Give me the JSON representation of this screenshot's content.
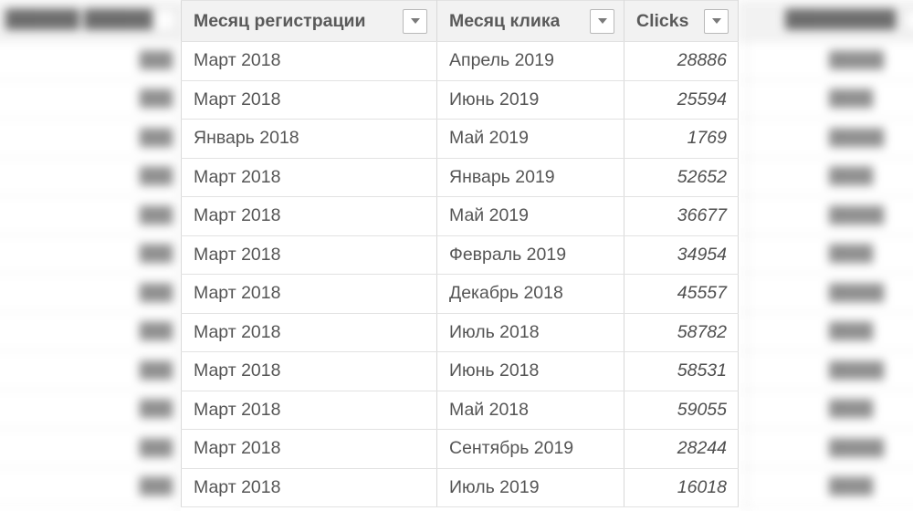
{
  "table": {
    "columns": [
      {
        "key": "reg_month",
        "label": "Месяц регистрации",
        "filter_icon": "chevron-down-icon",
        "align": "left"
      },
      {
        "key": "click_month",
        "label": "Месяц клика",
        "filter_icon": "chevron-down-icon",
        "align": "left"
      },
      {
        "key": "clicks",
        "label": "Clicks",
        "filter_icon": "chevron-down-icon",
        "align": "right"
      }
    ],
    "rows": [
      {
        "reg_month": "Март 2018",
        "click_month": "Апрель 2019",
        "clicks": "28886"
      },
      {
        "reg_month": "Март 2018",
        "click_month": "Июнь 2019",
        "clicks": "25594"
      },
      {
        "reg_month": "Январь 2018",
        "click_month": "Май 2019",
        "clicks": "1769"
      },
      {
        "reg_month": "Март 2018",
        "click_month": "Январь 2019",
        "clicks": "52652"
      },
      {
        "reg_month": "Март 2018",
        "click_month": "Май 2019",
        "clicks": "36677"
      },
      {
        "reg_month": "Март 2018",
        "click_month": "Февраль 2019",
        "clicks": "34954"
      },
      {
        "reg_month": "Март 2018",
        "click_month": "Декабрь 2018",
        "clicks": "45557"
      },
      {
        "reg_month": "Март 2018",
        "click_month": "Июль 2018",
        "clicks": "58782"
      },
      {
        "reg_month": "Март 2018",
        "click_month": "Июнь 2018",
        "clicks": "58531"
      },
      {
        "reg_month": "Март 2018",
        "click_month": "Май 2018",
        "clicks": "59055"
      },
      {
        "reg_month": "Март 2018",
        "click_month": "Сентябрь 2019",
        "clicks": "28244"
      },
      {
        "reg_month": "Март 2018",
        "click_month": "Июль 2019",
        "clicks": "16018"
      }
    ]
  },
  "out_of_focus": {
    "left_column": {
      "header_text": "██████ ██████",
      "cells": [
        "███",
        "███",
        "███",
        "███",
        "███",
        "███",
        "███",
        "███",
        "███",
        "███",
        "███",
        "███"
      ]
    },
    "right_column": {
      "header_text": "█████████",
      "cells": [
        "█████",
        "████",
        "█████",
        "████",
        "█████",
        "████",
        "█████",
        "████",
        "█████",
        "████",
        "█████",
        "████"
      ]
    }
  },
  "colors": {
    "header_bg": "#f2f2f2",
    "header_text": "#5a5a5a",
    "cell_text": "#555555",
    "grid_line": "#e2e2e2",
    "page_bg": "#ffffff"
  }
}
